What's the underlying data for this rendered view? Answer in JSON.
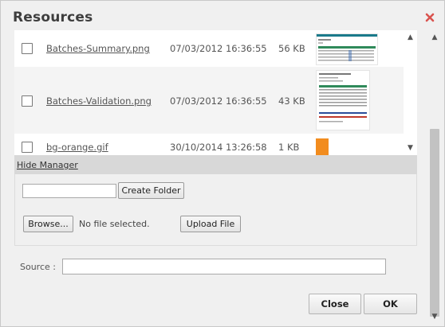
{
  "dialog": {
    "title": "Resources",
    "close_icon": "close-x-icon"
  },
  "files": [
    {
      "name": "Batches-Summary.png",
      "date": "07/03/2012 16:36:55",
      "size": "56 KB",
      "thumbnail": "screenshot-table"
    },
    {
      "name": "Batches-Validation.png",
      "date": "07/03/2012 16:36:55",
      "size": "43 KB",
      "thumbnail": "screenshot-report"
    },
    {
      "name": "bg-orange.gif",
      "date": "30/10/2014 13:26:58",
      "size": "1 KB",
      "thumbnail": "orange-swatch"
    }
  ],
  "manager": {
    "toggle_label": "Hide Manager",
    "folder_input_value": "",
    "create_folder_label": "Create Folder",
    "browse_label": "Browse...",
    "file_status": "No file selected.",
    "upload_label": "Upload File"
  },
  "source": {
    "label": "Source :",
    "value": ""
  },
  "footer": {
    "close_label": "Close",
    "ok_label": "OK"
  },
  "colors": {
    "close_icon": "#d9534f",
    "orange_swatch": "#f28c1e"
  }
}
